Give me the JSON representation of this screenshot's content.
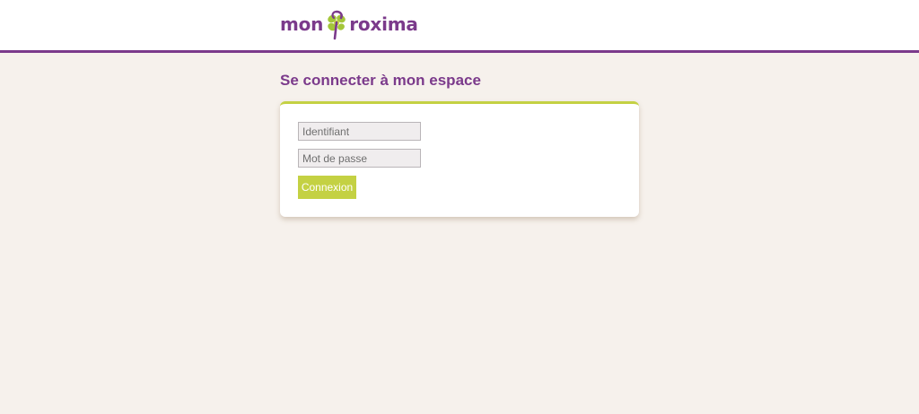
{
  "header": {
    "logo": {
      "text_left": "mon",
      "text_right": "roxima",
      "icon": "flower-p-icon",
      "colors": {
        "purple": "#7b3a8b",
        "green": "#a4c639"
      }
    },
    "border_color": "#7b3a8b"
  },
  "main": {
    "title": "Se connecter à mon espace",
    "login_form": {
      "identifier": {
        "value": "",
        "placeholder": "Identifiant"
      },
      "password": {
        "value": "",
        "placeholder": "Mot de passe"
      },
      "submit_label": "Connexion"
    }
  },
  "colors": {
    "accent_purple": "#7b3a8b",
    "accent_green": "#c4d143",
    "page_background": "#f6f1ec"
  }
}
